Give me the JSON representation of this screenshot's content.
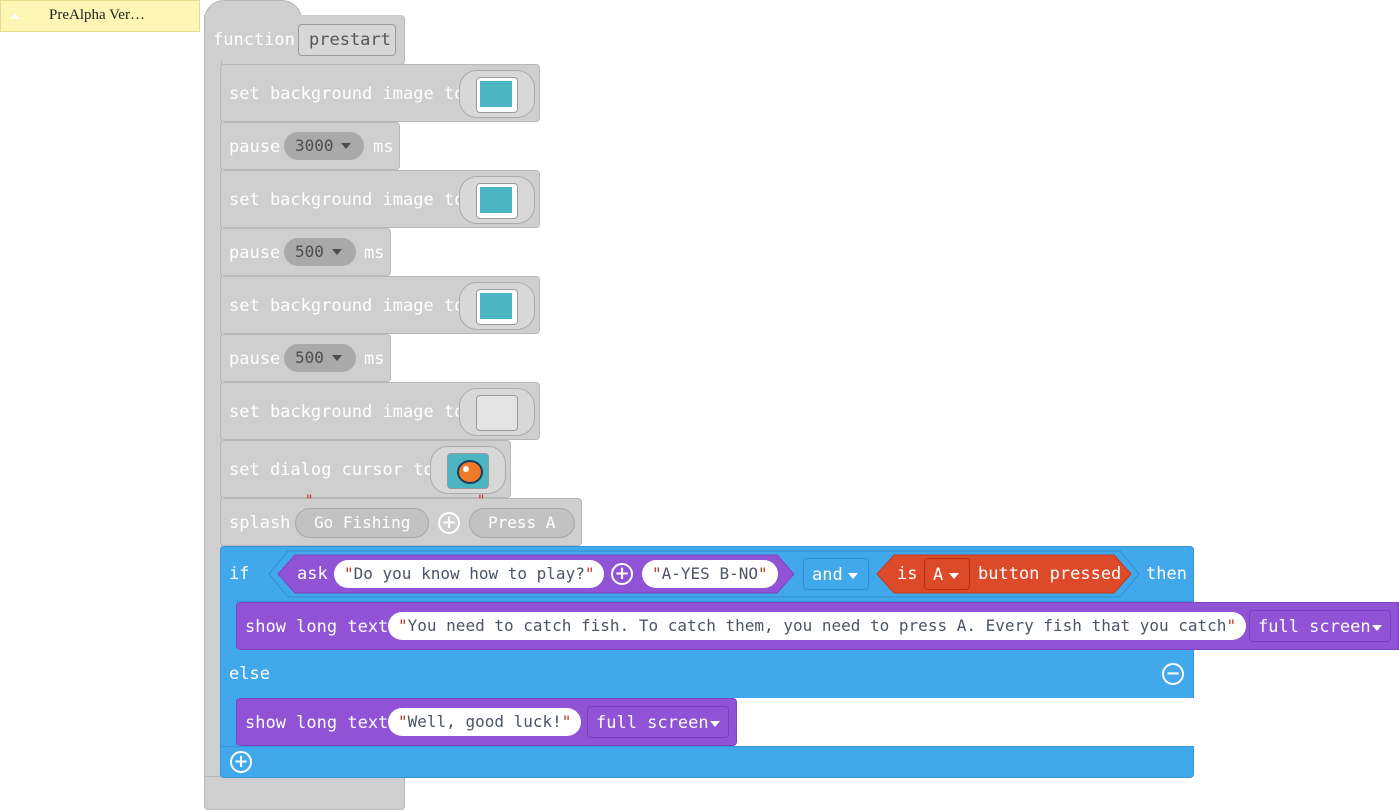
{
  "toolbox": {
    "label": "PreAlpha Ver…"
  },
  "function_block": {
    "keyword": "function",
    "name": "prestart"
  },
  "blocks": {
    "set_bg_label": "set background image to",
    "pause_label": "pause",
    "ms_label": "ms",
    "pauses": [
      "3000",
      "500",
      "500"
    ],
    "set_dialog_cursor_label": "set dialog cursor to",
    "splash_label": "splash",
    "splash_texts": [
      "Go Fishing",
      "Press A"
    ]
  },
  "if_block": {
    "if_label": "if",
    "ask_label": "ask",
    "ask_texts": [
      "Do you know how to play?",
      "A-YES B-NO"
    ],
    "and_label": "and",
    "is_label": "is",
    "button_value": "A",
    "button_pressed_label": "button pressed",
    "then_label": "then",
    "else_label": "else",
    "show_long_text_label": "show long text",
    "then_text": "You need to catch fish. To catch them, you need to press A. Every fish that you catch",
    "else_text": "Well, good luck!",
    "mode_label": "full screen"
  },
  "colors": {
    "toolbox_yellow": "#fdf6b4",
    "block_grey": "#cfcfcf",
    "logic_blue": "#42a8ec",
    "text_purple": "#9153d6",
    "controller_red": "#dd4a2a"
  }
}
